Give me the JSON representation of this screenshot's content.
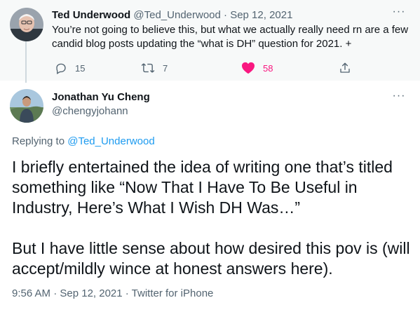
{
  "parent_tweet": {
    "name": "Ted Underwood",
    "handle": "@Ted_Underwood",
    "separator": "·",
    "date": "Sep 12, 2021",
    "more_label": "···",
    "text": "You’re not going to believe this, but what we actually really need rn are a few candid blog posts updating the “what is DH” question for 2021. +",
    "actions": {
      "replies": "15",
      "retweets": "7",
      "likes": "58"
    },
    "colors": {
      "like": "#f91880"
    }
  },
  "main_tweet": {
    "name": "Jonathan Yu Cheng",
    "handle": "@chengyjohann",
    "more_label": "···",
    "replying_to_prefix": "Replying to ",
    "replying_to_handle": "@Ted_Underwood",
    "paragraphs": [
      "I briefly entertained the idea of writing one that’s titled something like “Now That I Have To Be Useful in Industry, Here’s What I Wish DH Was…”",
      "But I have little sense about how desired this pov is (will accept/mildly wince at honest answers here)."
    ],
    "meta": "9:56 AM · Sep 12, 2021 · Twitter for iPhone"
  },
  "colors": {
    "link": "#1d9bf0",
    "muted": "#536471",
    "thread_line": "#cfd9de"
  },
  "icons": {
    "reply": "reply-icon",
    "retweet": "retweet-icon",
    "like": "heart-icon",
    "share": "share-icon",
    "more": "more-icon"
  }
}
